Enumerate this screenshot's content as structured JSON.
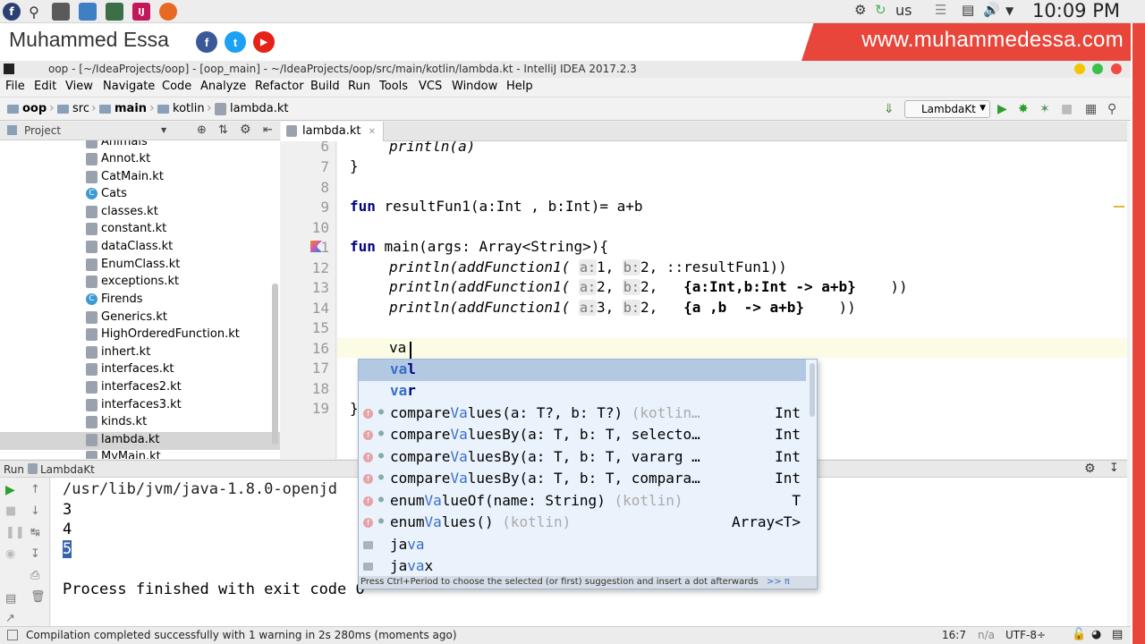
{
  "system_bar": {
    "keyboard_layout": "us",
    "clock": "10:09 PM"
  },
  "banner": {
    "name": "Muhammed Essa",
    "website": "www.muhammedessa.com",
    "social": {
      "facebook": "f",
      "twitter": "t",
      "youtube": "▶"
    }
  },
  "window": {
    "title": "oop - [~/IdeaProjects/oop] - [oop_main] - ~/IdeaProjects/oop/src/main/kotlin/lambda.kt - IntelliJ IDEA 2017.2.3",
    "colors": {
      "minimize": "#f5c400",
      "maximize": "#3cc04a",
      "close": "#ef4a43"
    }
  },
  "menu": [
    "File",
    "Edit",
    "View",
    "Navigate",
    "Code",
    "Analyze",
    "Refactor",
    "Build",
    "Run",
    "Tools",
    "VCS",
    "Window",
    "Help"
  ],
  "breadcrumbs": [
    "oop",
    "src",
    "main",
    "kotlin",
    "lambda.kt"
  ],
  "run_config": "LambdaKt",
  "project_panel": {
    "title": "Project",
    "files": [
      {
        "name": "Animals",
        "kind": "file"
      },
      {
        "name": "Annot.kt",
        "kind": "file"
      },
      {
        "name": "CatMain.kt",
        "kind": "file"
      },
      {
        "name": "Cats",
        "kind": "class"
      },
      {
        "name": "classes.kt",
        "kind": "file"
      },
      {
        "name": "constant.kt",
        "kind": "file"
      },
      {
        "name": "dataClass.kt",
        "kind": "file"
      },
      {
        "name": "EnumClass.kt",
        "kind": "file"
      },
      {
        "name": "exceptions.kt",
        "kind": "file"
      },
      {
        "name": "Firends",
        "kind": "class"
      },
      {
        "name": "Generics.kt",
        "kind": "file"
      },
      {
        "name": "HighOrderedFunction.kt",
        "kind": "file"
      },
      {
        "name": "inhert.kt",
        "kind": "file"
      },
      {
        "name": "interfaces.kt",
        "kind": "file"
      },
      {
        "name": "interfaces2.kt",
        "kind": "file"
      },
      {
        "name": "interfaces3.kt",
        "kind": "file"
      },
      {
        "name": "kinds.kt",
        "kind": "file"
      },
      {
        "name": "lambda.kt",
        "kind": "file",
        "selected": true
      },
      {
        "name": "MyMain.kt",
        "kind": "file"
      }
    ]
  },
  "editor": {
    "tab": "lambda.kt",
    "line_numbers": [
      "6",
      "7",
      "8",
      "9",
      "10",
      "11",
      "12",
      "13",
      "14",
      "15",
      "16",
      "17",
      "18",
      "19"
    ],
    "lines": {
      "l6": "println(a)",
      "l7": "}",
      "l9_kw": "fun",
      "l9_rest": " resultFun1(a:Int , b:Int)= a+b",
      "l11_kw": "fun",
      "l11_rest": " main(args: Array<String>){",
      "call": "println(addFunction1(",
      "hint_a": "a:",
      "hint_b": "b:",
      "l12_a": "1,",
      "l12_b": "2,",
      "l12_tail": " ::resultFun1))",
      "l13_a": "2,",
      "l13_b": "2,",
      "l13_lambda": "{a:Int,b:Int -> a+b}",
      "l13_tail": "    ))",
      "l14_a": "3,",
      "l14_b": "2,",
      "l14_lambda": "{a ,b  -> a+b}",
      "l14_tail": "    ))",
      "l16": "va",
      "l19": "}"
    }
  },
  "completion": {
    "typed": "va",
    "items": [
      {
        "pre": "",
        "match": "va",
        "post": "l",
        "keyword": true,
        "type": ""
      },
      {
        "pre": "",
        "match": "va",
        "post": "r",
        "keyword": true,
        "type": ""
      },
      {
        "pre": "compare",
        "match": "Va",
        "post": "lues(a: T?, b: T?)",
        "gray": " (kotlin…",
        "type": "Int"
      },
      {
        "pre": "compare",
        "match": "Va",
        "post": "luesBy(a: T, b: T, selecto…",
        "gray": "",
        "type": "Int"
      },
      {
        "pre": "compare",
        "match": "Va",
        "post": "luesBy(a: T, b: T, vararg …",
        "gray": "",
        "type": "Int"
      },
      {
        "pre": "compare",
        "match": "Va",
        "post": "luesBy(a: T, b: T, compara…",
        "gray": "",
        "type": "Int"
      },
      {
        "pre": "enum",
        "match": "Va",
        "post": "lueOf(name: String)",
        "gray": " (kotlin)",
        "type": "T"
      },
      {
        "pre": "enum",
        "match": "Va",
        "post": "lues()",
        "gray": " (kotlin)",
        "type": "Array<T>"
      },
      {
        "pre": "ja",
        "match": "va",
        "post": "",
        "gray": "",
        "type": "",
        "folder": true
      },
      {
        "pre": "ja",
        "match": "va",
        "post": "x",
        "gray": "",
        "type": "",
        "folder": true
      }
    ],
    "footer": "Press Ctrl+Period to choose the selected (or first) suggestion and insert a dot afterwards",
    "footer_link": ">>",
    "footer_pi": "π"
  },
  "run_panel": {
    "label": "Run",
    "config": "LambdaKt",
    "output": [
      "/usr/lib/jvm/java-1.8.0-openjd",
      "3",
      "4",
      "5",
      "",
      "Process finished with exit code 0"
    ]
  },
  "status_bar": {
    "message": "Compilation completed successfully with 1 warning in 2s 280ms (moments ago)",
    "position": "16:7",
    "na": "n/a",
    "encoding": "UTF-8÷"
  }
}
